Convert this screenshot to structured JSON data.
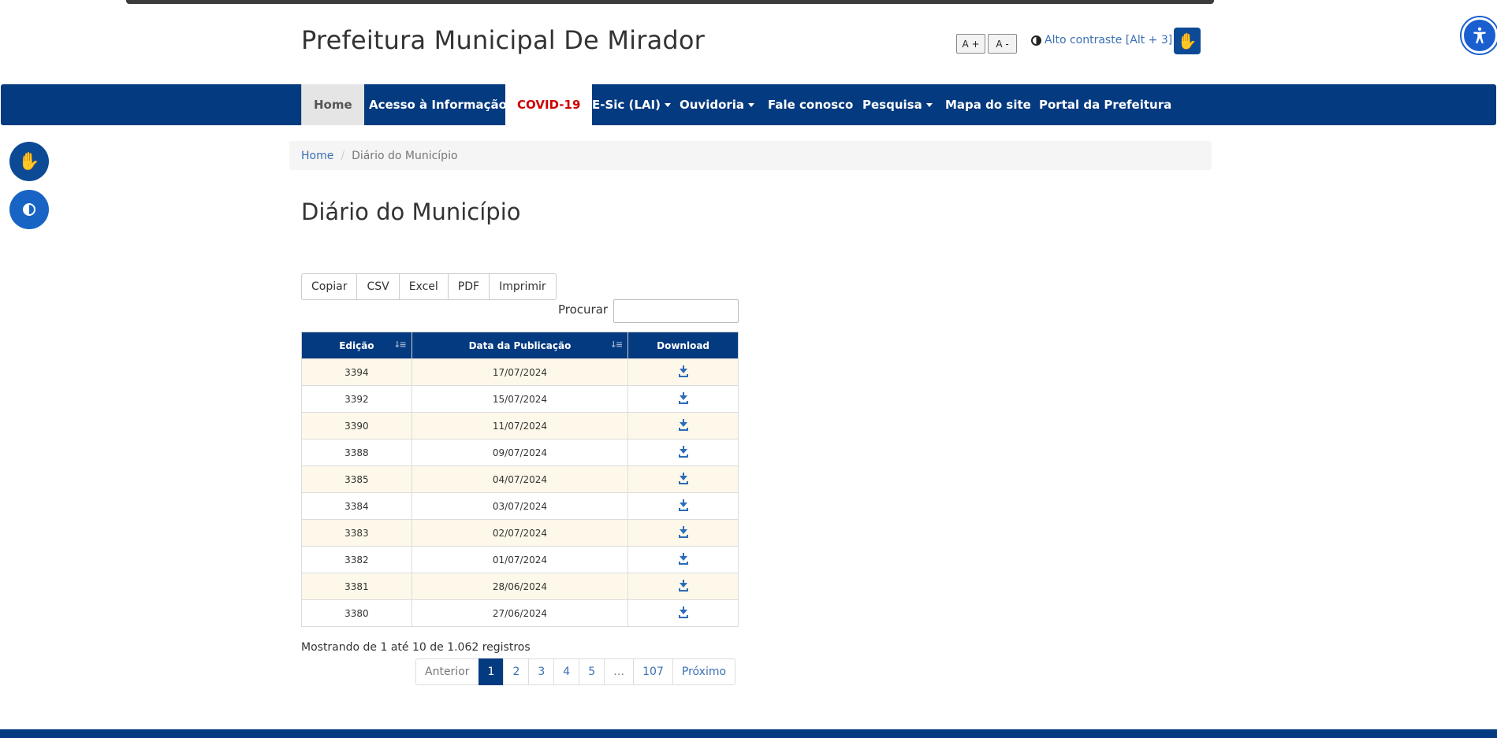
{
  "header": {
    "site_title": "Prefeitura Municipal De Mirador",
    "font_increase": "A +",
    "font_decrease": "A -",
    "contrast_label": "Alto contraste [Alt + 3]",
    "libras_icon": "sign-language-icon",
    "accessibility_icon": "accessibility-person-icon"
  },
  "nav": {
    "items": [
      {
        "label": "Home",
        "dropdown": false
      },
      {
        "label": "Acesso à Informação",
        "dropdown": true
      },
      {
        "label": "COVID-19",
        "dropdown": false
      },
      {
        "label": "E-Sic (LAI)",
        "dropdown": true
      },
      {
        "label": "Ouvidoria",
        "dropdown": true
      },
      {
        "label": "Fale conosco",
        "dropdown": false
      },
      {
        "label": "Pesquisa",
        "dropdown": true
      },
      {
        "label": "Mapa do site",
        "dropdown": false
      },
      {
        "label": "Portal da Prefeitura",
        "dropdown": false
      }
    ]
  },
  "side_widgets": {
    "libras_icon": "sign-language-icon",
    "contrast_icon": "contrast-icon"
  },
  "breadcrumb": {
    "home": "Home",
    "separator": "/",
    "current": "Diário do Município"
  },
  "main": {
    "title": "Diário do Município",
    "export_buttons": [
      "Copiar",
      "CSV",
      "Excel",
      "PDF",
      "Imprimir"
    ],
    "search_label": "Procurar",
    "search_value": "",
    "table": {
      "columns": [
        "Edição",
        "Data da Publicação",
        "Download"
      ],
      "rows": [
        {
          "edicao": "3394",
          "data": "17/07/2024"
        },
        {
          "edicao": "3392",
          "data": "15/07/2024"
        },
        {
          "edicao": "3390",
          "data": "11/07/2024"
        },
        {
          "edicao": "3388",
          "data": "09/07/2024"
        },
        {
          "edicao": "3385",
          "data": "04/07/2024"
        },
        {
          "edicao": "3384",
          "data": "03/07/2024"
        },
        {
          "edicao": "3383",
          "data": "02/07/2024"
        },
        {
          "edicao": "3382",
          "data": "01/07/2024"
        },
        {
          "edicao": "3381",
          "data": "28/06/2024"
        },
        {
          "edicao": "3380",
          "data": "27/06/2024"
        }
      ],
      "download_icon": "download-icon"
    },
    "info_text": "Mostrando de 1 até 10 de 1.062 registros",
    "pagination": [
      "Anterior",
      "1",
      "2",
      "3",
      "4",
      "5",
      "…",
      "107",
      "Próximo"
    ],
    "current_page": "1"
  },
  "colors": {
    "brand_blue": "#043a7f",
    "link_blue": "#3b6fb3",
    "covid_red": "#d00000",
    "row_highlight": "#fdf8e9"
  }
}
